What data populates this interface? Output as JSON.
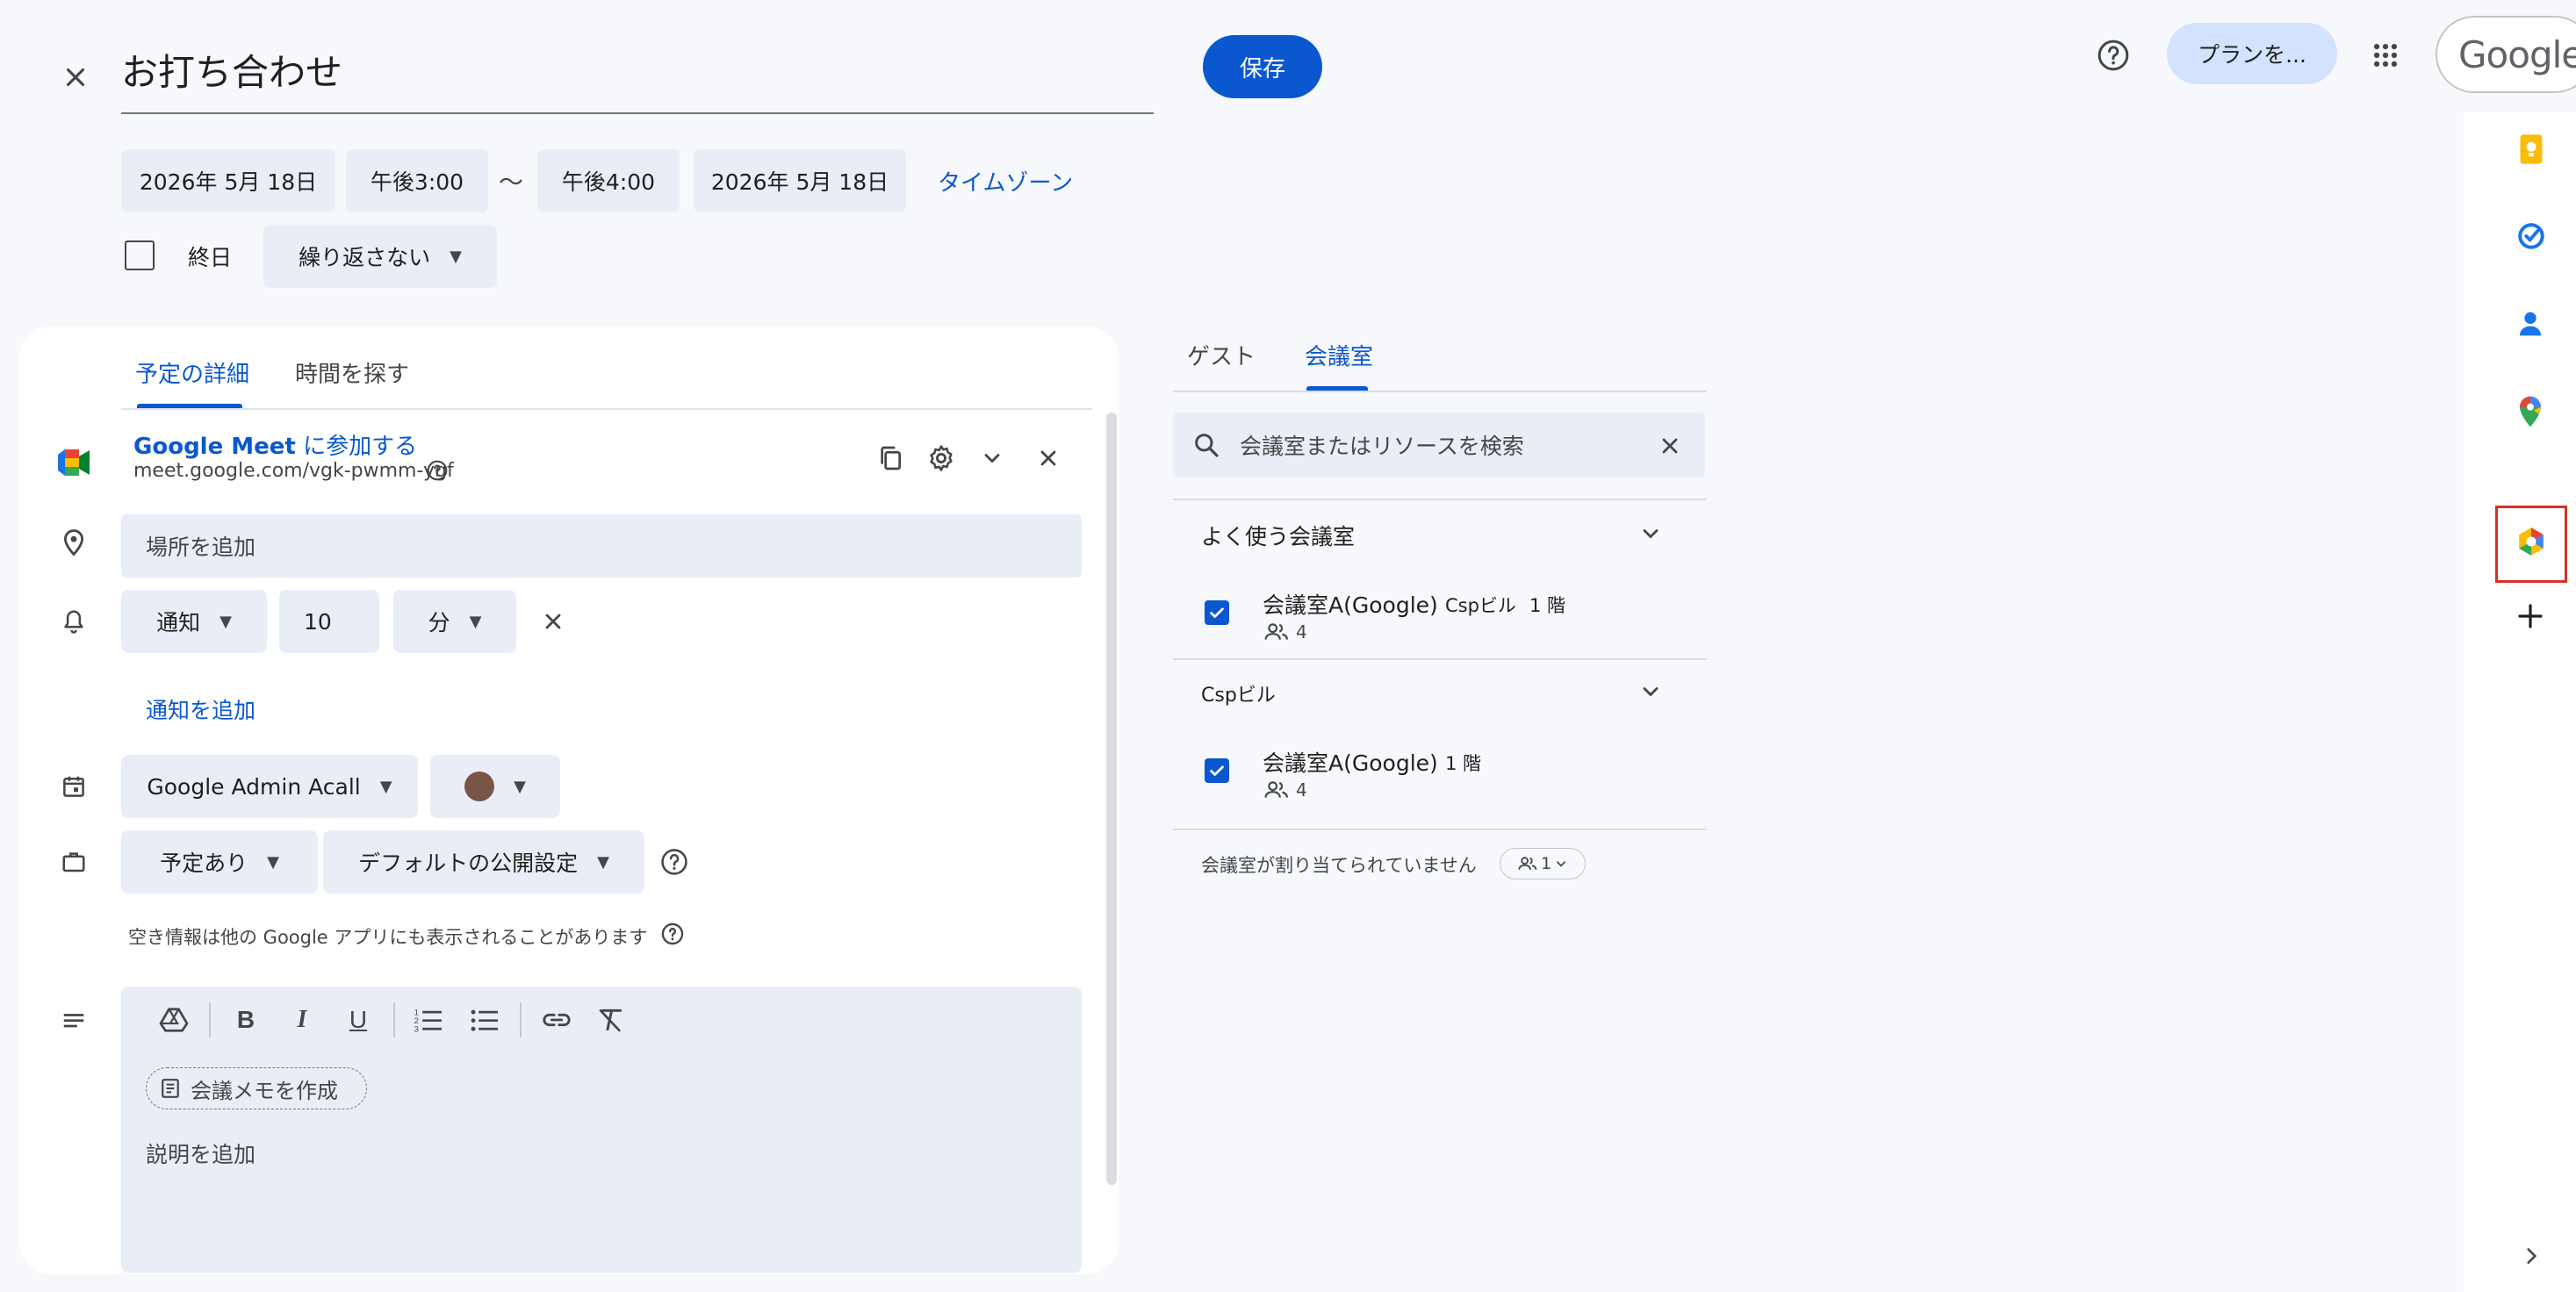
{
  "header": {
    "title": "お打ち合わせ",
    "save_label": "保存",
    "plan_label": "プランを...",
    "google_label": "Google"
  },
  "datetime": {
    "start_date": "2026年 5月 18日",
    "start_time": "午後3:00",
    "separator": "～",
    "end_time": "午後4:00",
    "end_date": "2026年 5月 18日",
    "timezone_label": "タイムゾーン",
    "allday_label": "終日",
    "repeat_label": "繰り返さない"
  },
  "left_tabs": {
    "details": "予定の詳細",
    "find_time": "時間を探す"
  },
  "meet": {
    "join_label_brand": "Google Meet",
    "join_label_rest": " に参加する",
    "url": "meet.google.com/vgk-pwmm-ygf"
  },
  "location": {
    "placeholder": "場所を追加"
  },
  "notification": {
    "type": "通知",
    "value": "10",
    "unit": "分",
    "add_label": "通知を追加"
  },
  "calendar": {
    "name": "Google Admin Acall",
    "color": "#795548"
  },
  "availability": {
    "status": "予定あり",
    "visibility": "デフォルトの公開設定",
    "note": "空き情報は他の Google アプリにも表示されることがあります"
  },
  "description": {
    "meeting_notes_label": "会議メモを作成",
    "placeholder": "説明を追加"
  },
  "right_tabs": {
    "guests": "ゲスト",
    "rooms": "会議室"
  },
  "room_search": {
    "placeholder": "会議室またはリソースを検索"
  },
  "rooms": {
    "favorites_header": "よく使う会議室",
    "favorites": [
      {
        "name": "会議室A(Google)",
        "building": "Cspビル",
        "floor": "1 階",
        "capacity": "4",
        "checked": true
      }
    ],
    "building_header": "Cspビル",
    "building_rooms": [
      {
        "name": "会議室A(Google)",
        "floor": "1 階",
        "capacity": "4",
        "checked": true
      }
    ],
    "unassigned_label": "会議室が割り当てられていません",
    "unassigned_count": "1"
  },
  "side_icons": [
    "keep-icon",
    "tasks-icon",
    "contacts-icon",
    "maps-icon",
    "addon-icon",
    "add-icon",
    "expand-icon"
  ],
  "colors": {
    "accent": "#0b57d0",
    "background": "#f6f8fc",
    "chip": "#e9eef6",
    "highlight_border": "#d93025"
  }
}
